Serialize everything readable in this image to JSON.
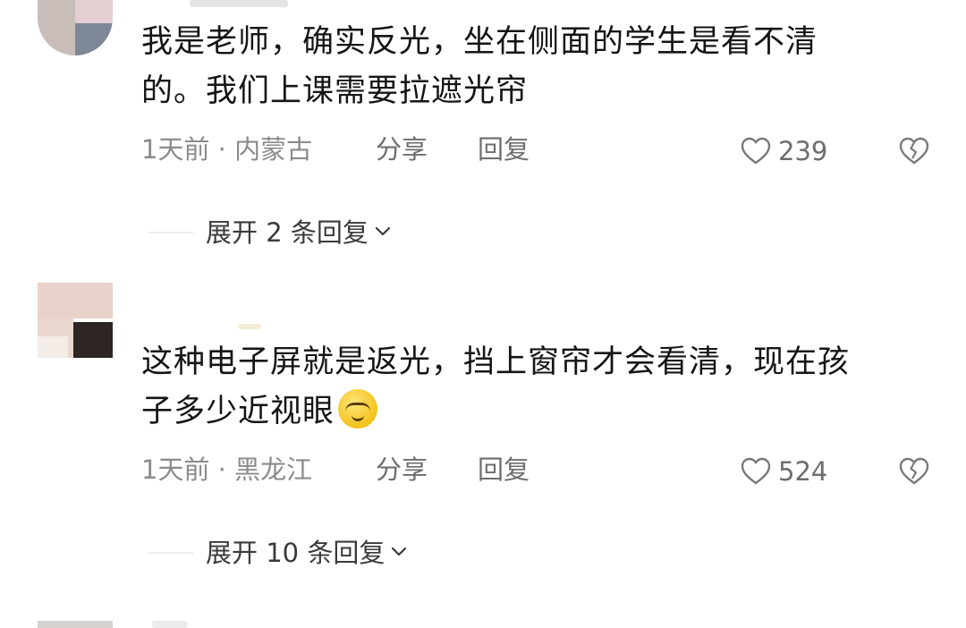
{
  "comments": [
    {
      "text_lines": [
        "我是老师，确实反光，坐在侧面的学生是看不清",
        "的。我们上课需要拉遮光帘"
      ],
      "meta": "1天前 · 内蒙古",
      "share_label": "分享",
      "reply_label": "回复",
      "like_count": "239",
      "expand_label": "展开 2 条回复"
    },
    {
      "text_lines": [
        "这种电子屏就是返光，挡上窗帘才会看清，现在孩",
        "子多少近视眼"
      ],
      "emoji_icon": "smirk-emoji-icon",
      "meta": "1天前 · 黑龙江",
      "share_label": "分享",
      "reply_label": "回复",
      "like_count": "524",
      "expand_label": "展开 10 条回复"
    }
  ],
  "icons": {
    "like": "heart-outline-icon",
    "dislike": "broken-heart-icon",
    "expand": "chevron-down-icon"
  },
  "colors": {
    "text_primary": "#151515",
    "text_meta": "#8b8b8b",
    "text_action": "#6d6d6d",
    "background": "#ffffff"
  }
}
